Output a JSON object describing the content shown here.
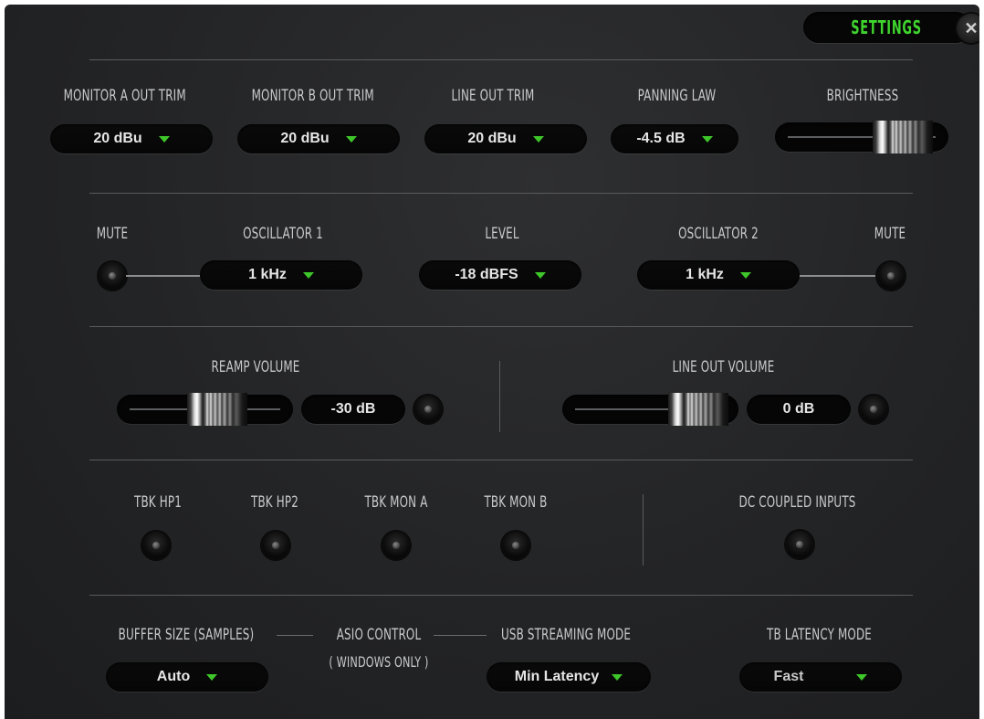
{
  "window": {
    "title": "SETTINGS",
    "close_glyph": "✕"
  },
  "outputs": {
    "monitor_a": {
      "label": "MONITOR A OUT TRIM",
      "value": "20 dBu"
    },
    "monitor_b": {
      "label": "MONITOR B OUT TRIM",
      "value": "20 dBu"
    },
    "line_out": {
      "label": "LINE OUT TRIM",
      "value": "20 dBu"
    },
    "panning": {
      "label": "PANNING LAW",
      "value": "-4.5 dB"
    },
    "brightness": {
      "label": "BRIGHTNESS",
      "level": 0.86
    }
  },
  "oscillator": {
    "mute1_label": "MUTE",
    "osc1": {
      "label": "OSCILLATOR 1",
      "value": "1 kHz"
    },
    "level": {
      "label": "LEVEL",
      "value": "-18 dBFS"
    },
    "osc2": {
      "label": "OSCILLATOR 2",
      "value": "1 kHz"
    },
    "mute2_label": "MUTE"
  },
  "volumes": {
    "reamp": {
      "label": "REAMP VOLUME",
      "value": "-30 dB"
    },
    "line_out": {
      "label": "LINE OUT VOLUME",
      "value": "0 dB"
    }
  },
  "talkback": {
    "items": [
      {
        "label": "TBK HP1"
      },
      {
        "label": "TBK HP2"
      },
      {
        "label": "TBK MON A"
      },
      {
        "label": "TBK MON B"
      }
    ],
    "dc_coupled": {
      "label": "DC COUPLED INPUTS"
    }
  },
  "system": {
    "buffer": {
      "label": "BUFFER SIZE (SAMPLES)",
      "value": "Auto"
    },
    "asio": {
      "label": "ASIO CONTROL",
      "sublabel": "( WINDOWS ONLY )"
    },
    "usb": {
      "label": "USB STREAMING MODE",
      "value": "Min Latency"
    },
    "tb_latency": {
      "label": "TB LATENCY MODE",
      "value": "Fast"
    }
  },
  "colors": {
    "accent_green": "#3fd42e",
    "panel_bg": "#252628"
  }
}
